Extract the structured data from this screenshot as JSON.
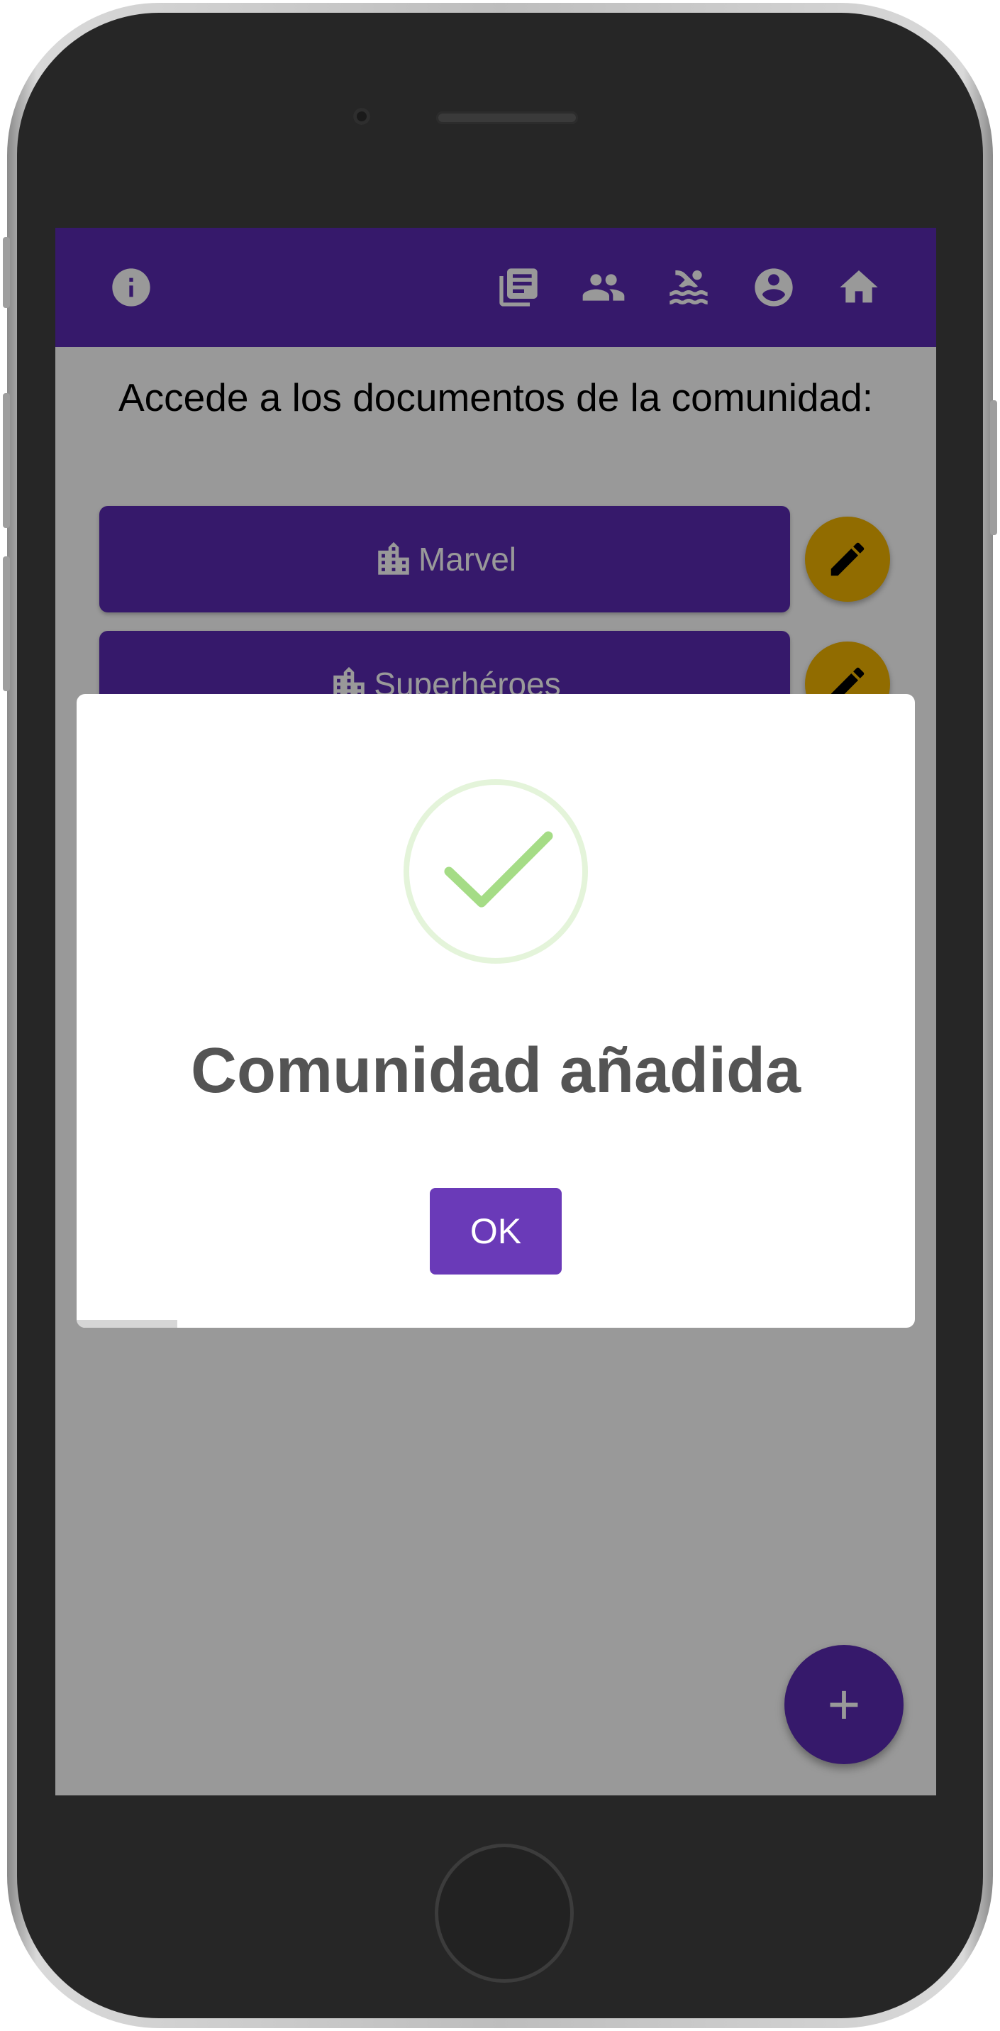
{
  "app_bar": {
    "icons": [
      "info-icon",
      "library-books-icon",
      "people-icon",
      "pool-icon",
      "account-circle-icon",
      "home-icon"
    ]
  },
  "content": {
    "title": "Accede a los documentos de la comunidad:",
    "communities": [
      {
        "label": "Marvel",
        "icon": "building-icon"
      },
      {
        "label": "Superhéroes",
        "icon": "building-icon"
      }
    ],
    "edit_icon": "pencil-icon",
    "add_label": "+"
  },
  "dialog": {
    "icon": "success-check-icon",
    "title": "Comunidad añadida",
    "ok_label": "OK",
    "timer_progress": 0.12
  },
  "colors": {
    "primary": "#5b2bb3",
    "accent": "#f2b500",
    "success": "#a5dc86",
    "dialog_title": "#545454",
    "button": "#6a3ab8"
  }
}
